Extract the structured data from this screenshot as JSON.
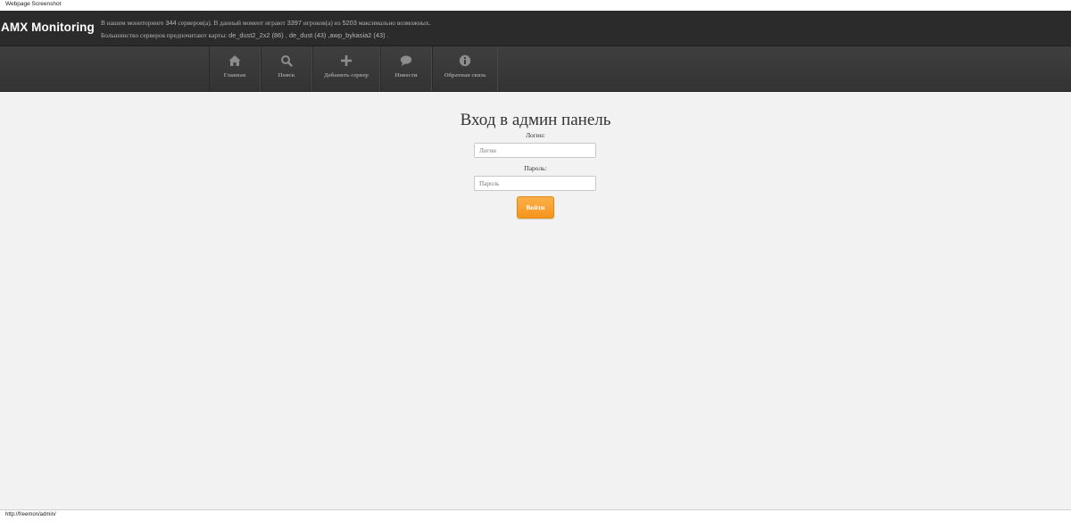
{
  "caption": "Webpage Screenshot",
  "header": {
    "brand": "AMX Monitoring",
    "stats_line1": {
      "t1": "В нашем мониторинге",
      "servers": "344",
      "t2": "серверов(а). В данный момент играют",
      "players": "3397",
      "t3": "игроков(а) из",
      "max": "5203",
      "t4": "максимально возможных."
    },
    "stats_line2": {
      "t1": "Большинство серверов предпочитают карты:",
      "maps": "de_dust2_2x2 (86) , de_dust (43) ,awp_bykasia2 (43) ."
    }
  },
  "nav": {
    "items": [
      {
        "label": "Главная",
        "icon": "home-icon"
      },
      {
        "label": "Поиск",
        "icon": "search-icon"
      },
      {
        "label": "Добавить сервер",
        "icon": "plus-icon"
      },
      {
        "label": "Новости",
        "icon": "comment-icon"
      },
      {
        "label": "Обратная связь",
        "icon": "info-icon"
      }
    ]
  },
  "login": {
    "title": "Вход в админ панель",
    "login_label": "Логин:",
    "login_placeholder": "Логин",
    "login_value": "",
    "password_label": "Пароль:",
    "password_placeholder": "Пароль",
    "password_value": "",
    "submit_label": "Войти"
  },
  "status_bar": {
    "url": "http://freemon/admin/"
  },
  "colors": {
    "header_bg": "#2b2b2b",
    "nav_bg": "#383838",
    "page_bg": "#f2f2f2",
    "button_accent": "#f7941d"
  }
}
